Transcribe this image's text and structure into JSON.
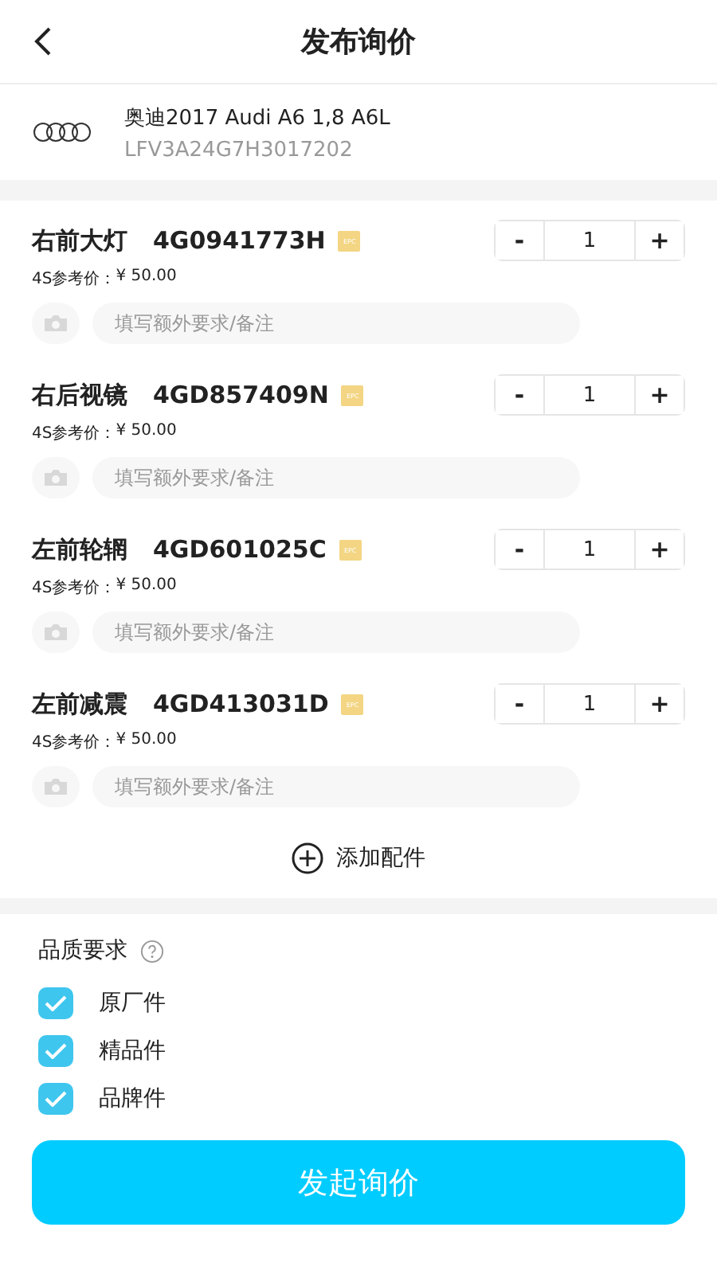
{
  "header": {
    "title": "发布询价"
  },
  "vehicle": {
    "name": "奥迪2017 Audi A6 1,8 A6L",
    "vin": "LFV3A24G7H3017202"
  },
  "parts": [
    {
      "name": "右前大灯",
      "code": "4G0941773H",
      "badge": "EPC",
      "price_label": "4S参考价：",
      "price": "¥ 50.00",
      "quantity": "1",
      "minus": "-",
      "plus": "+",
      "placeholder": "填写额外要求/备注"
    },
    {
      "name": "右后视镜",
      "code": "4GD857409N",
      "badge": "EPC",
      "price_label": "4S参考价：",
      "price": "¥ 50.00",
      "quantity": "1",
      "minus": "-",
      "plus": "+",
      "placeholder": "填写额外要求/备注"
    },
    {
      "name": "左前轮辋",
      "code": "4GD601025C",
      "badge": "EPC",
      "price_label": "4S参考价：",
      "price": "¥ 50.00",
      "quantity": "1",
      "minus": "-",
      "plus": "+",
      "placeholder": "填写额外要求/备注"
    },
    {
      "name": "左前减震",
      "code": "4GD413031D",
      "badge": "EPC",
      "price_label": "4S参考价：",
      "price": "¥ 50.00",
      "quantity": "1",
      "minus": "-",
      "plus": "+",
      "placeholder": "填写额外要求/备注"
    }
  ],
  "add_part": {
    "label": "添加配件"
  },
  "quality": {
    "title": "品质要求",
    "options": [
      {
        "label": "原厂件",
        "checked": true
      },
      {
        "label": "精品件",
        "checked": true
      },
      {
        "label": "品牌件",
        "checked": true
      }
    ]
  },
  "submit": {
    "label": "发起询价"
  }
}
